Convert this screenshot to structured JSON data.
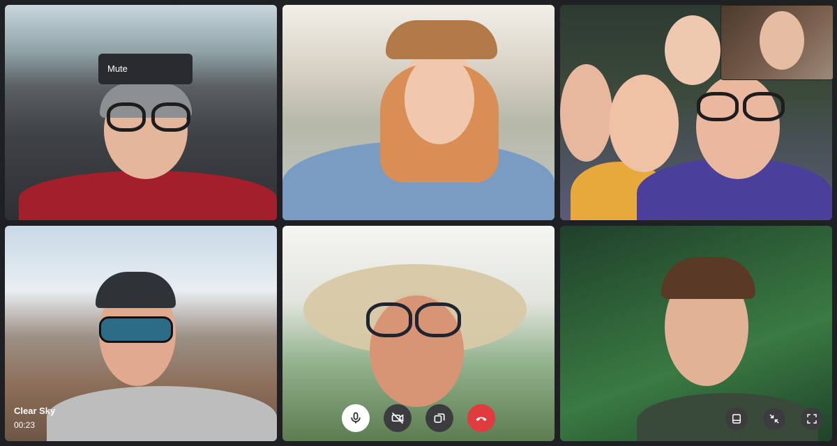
{
  "tooltip": {
    "label": "Mute"
  },
  "participants": [
    {
      "tile": "1"
    },
    {
      "tile": "2"
    },
    {
      "tile": "3"
    },
    {
      "tile": "4",
      "name": "Clear Sky",
      "duration": "00:23"
    },
    {
      "tile": "5"
    },
    {
      "tile": "6"
    }
  ],
  "controls": {
    "mic_icon": "microphone-icon",
    "camera_icon": "video-off-icon",
    "share_icon": "screen-share-icon",
    "end_icon": "hang-up-icon",
    "layout_icon": "layout-icon",
    "minimize_icon": "exit-fullscreen-icon",
    "fullscreen_icon": "fullscreen-icon"
  },
  "colors": {
    "background": "#1f2023",
    "end_call": "#e03b3f",
    "control_dark": "#3c3c3f",
    "control_active": "#ffffff"
  }
}
